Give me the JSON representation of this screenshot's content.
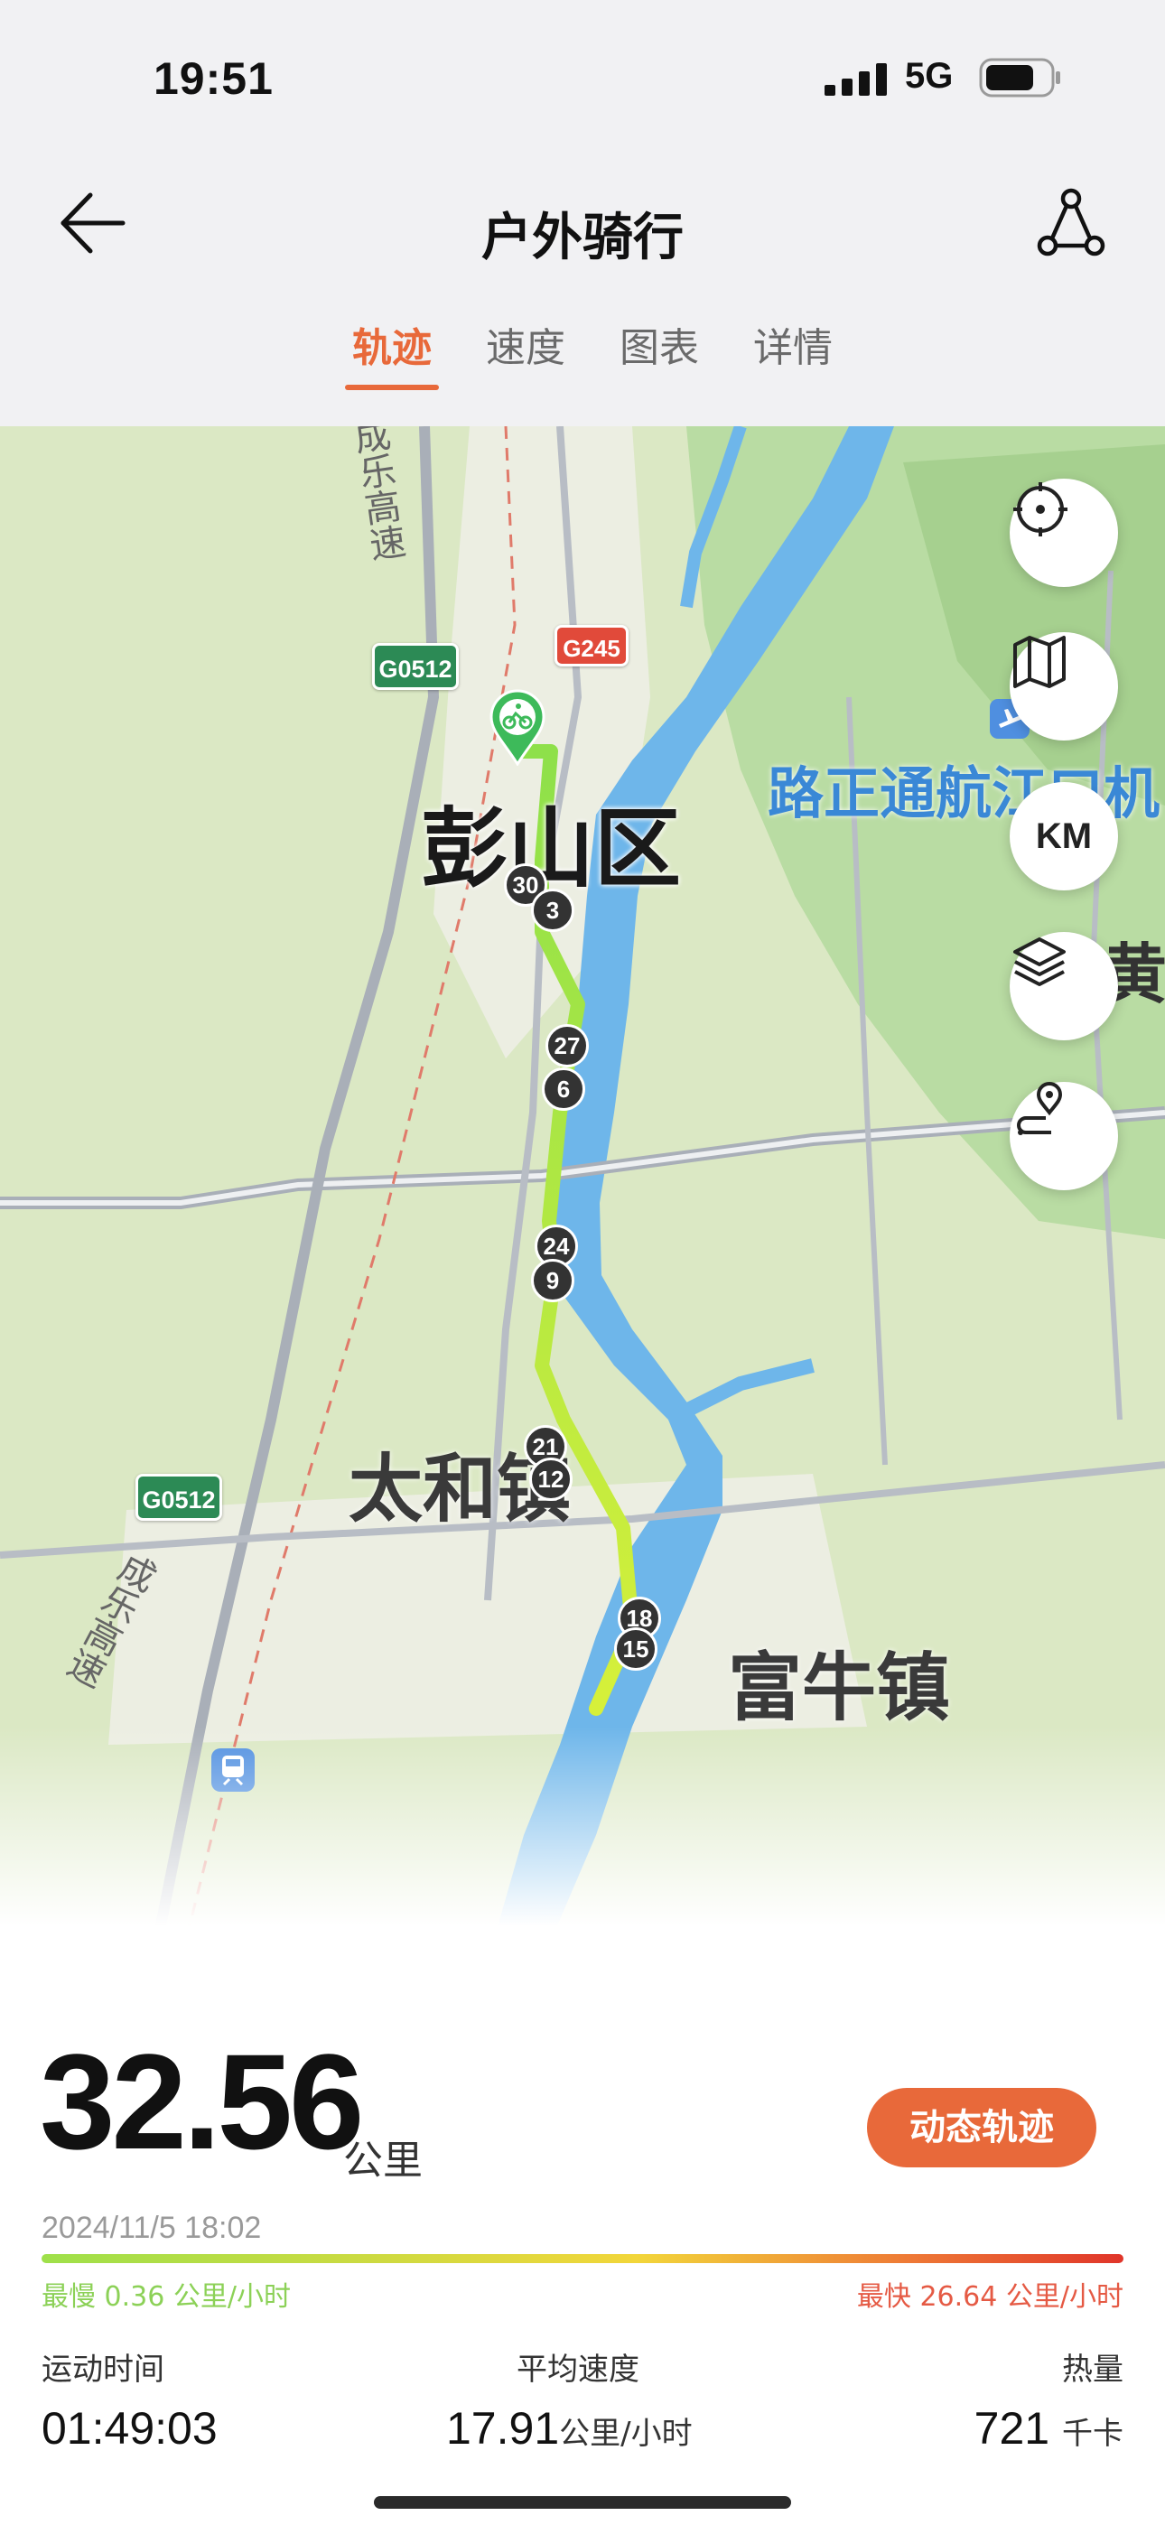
{
  "status_bar": {
    "time": "19:51",
    "network": "5G"
  },
  "header": {
    "title": "户外骑行"
  },
  "tabs": [
    {
      "label": "轨迹",
      "active": true
    },
    {
      "label": "速度",
      "active": false
    },
    {
      "label": "图表",
      "active": false
    },
    {
      "label": "详情",
      "active": false
    }
  ],
  "map": {
    "labels": {
      "district": "彭山区",
      "town1": "太和镇",
      "town2": "富牛镇",
      "airport": "路正通航江口机",
      "highway_vertical": "成乐高速",
      "highway_bottom": "成乐高速",
      "shield1": "G0512",
      "shield2": "G245",
      "shield3": "G0512",
      "edge_char": "黄"
    },
    "km_markers": [
      "30",
      "3",
      "27",
      "6",
      "24",
      "9",
      "21",
      "12",
      "18",
      "15"
    ],
    "km_button_label": "KM",
    "colors": {
      "route_start": "#8ee04a",
      "route_end": "#d6f03a",
      "water": "#6eb6ea",
      "land": "#dbe8c4",
      "forest": "#b9dca3"
    },
    "controls": [
      "locate-icon",
      "map-icon",
      "km-toggle",
      "layers-icon",
      "route-pin-icon"
    ]
  },
  "summary": {
    "distance": "32.56",
    "distance_unit": "公里",
    "dynamic_track_button": "动态轨迹",
    "date": "2024/11/5 18:02",
    "slowest": "最慢 0.36 公里/小时",
    "fastest": "最快 26.64 公里/小时"
  },
  "metrics": [
    {
      "label": "运动时间",
      "value": "01:49:03",
      "unit": ""
    },
    {
      "label": "平均速度",
      "value": "17.91",
      "unit": "公里/小时"
    },
    {
      "label": "热量",
      "value": "721",
      "unit": "千卡"
    }
  ],
  "accent_color": "#e8693a"
}
